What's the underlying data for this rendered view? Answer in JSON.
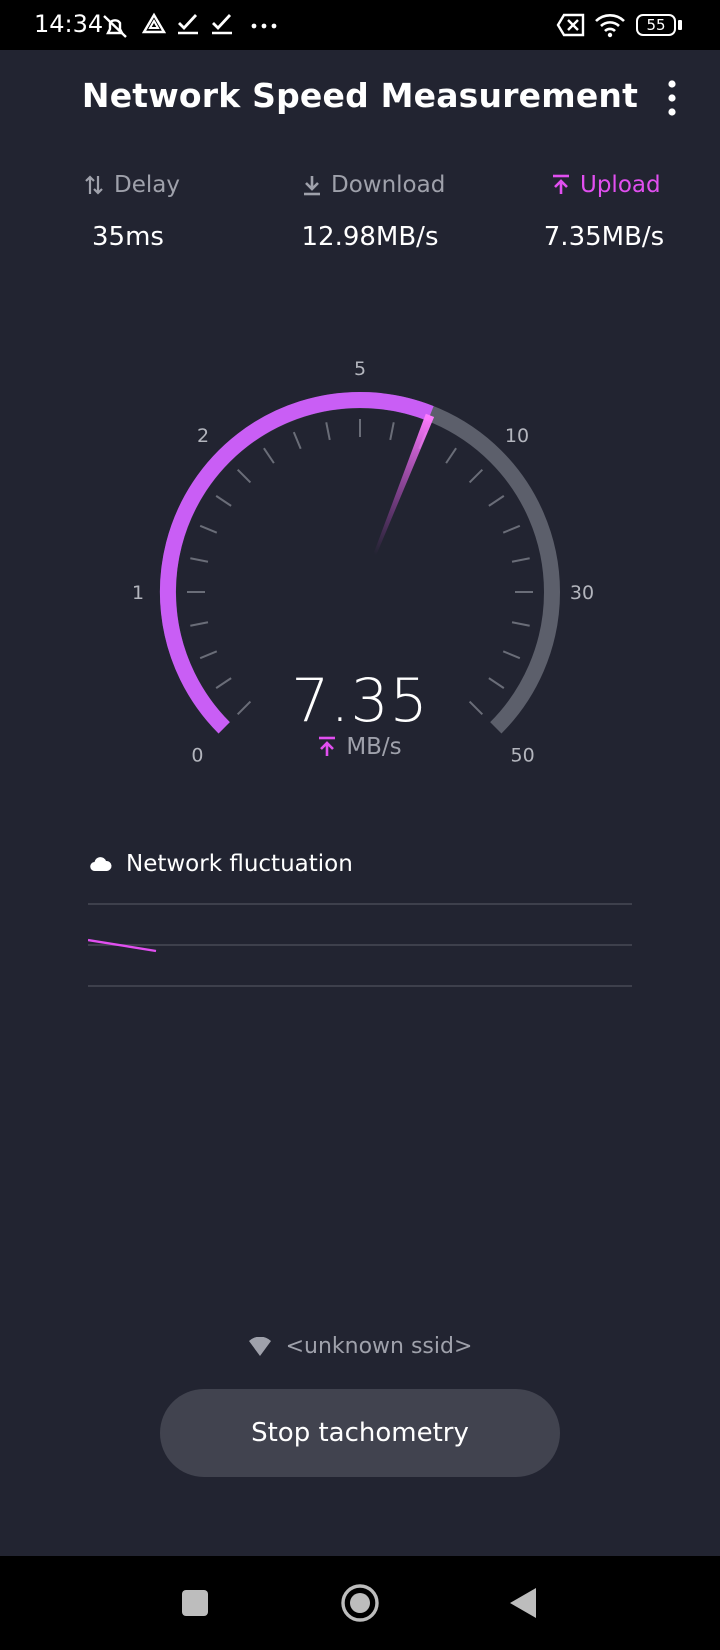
{
  "status_bar": {
    "time": "14:34",
    "battery": "55",
    "icons": [
      "muted-alarm-icon",
      "drive-icon",
      "check-icon",
      "check-icon",
      "more-dots-icon",
      "sim-off-icon",
      "wifi-icon",
      "battery-icon"
    ]
  },
  "header": {
    "title": "Network Speed Measurement",
    "menu_icon": "more-vertical-icon"
  },
  "metrics": {
    "delay": {
      "label": "Delay",
      "value": "35ms",
      "icon": "swap-arrows-icon"
    },
    "download": {
      "label": "Download",
      "value": "12.98MB/s",
      "icon": "download-icon"
    },
    "upload": {
      "label": "Upload",
      "value": "7.35MB/s",
      "icon": "upload-icon"
    }
  },
  "gauge": {
    "value": "7.35",
    "unit": "MB/s",
    "scale_labels": [
      "0",
      "1",
      "2",
      "5",
      "10",
      "30",
      "50"
    ],
    "fill_fraction": 0.58
  },
  "fluctuation": {
    "title": "Network fluctuation",
    "icon": "cloud-icon"
  },
  "ssid": {
    "text": "<unknown ssid>",
    "icon": "wifi-signal-icon"
  },
  "stop_button": {
    "label": "Stop tachometry"
  },
  "nav": {
    "icons": [
      "recents-square-icon",
      "home-circle-icon",
      "back-triangle-icon"
    ]
  },
  "colors": {
    "accent": "#e14ff0",
    "gauge_gradient_start": "#c95ef5",
    "track": "#5c5f6b",
    "background": "#222431"
  }
}
